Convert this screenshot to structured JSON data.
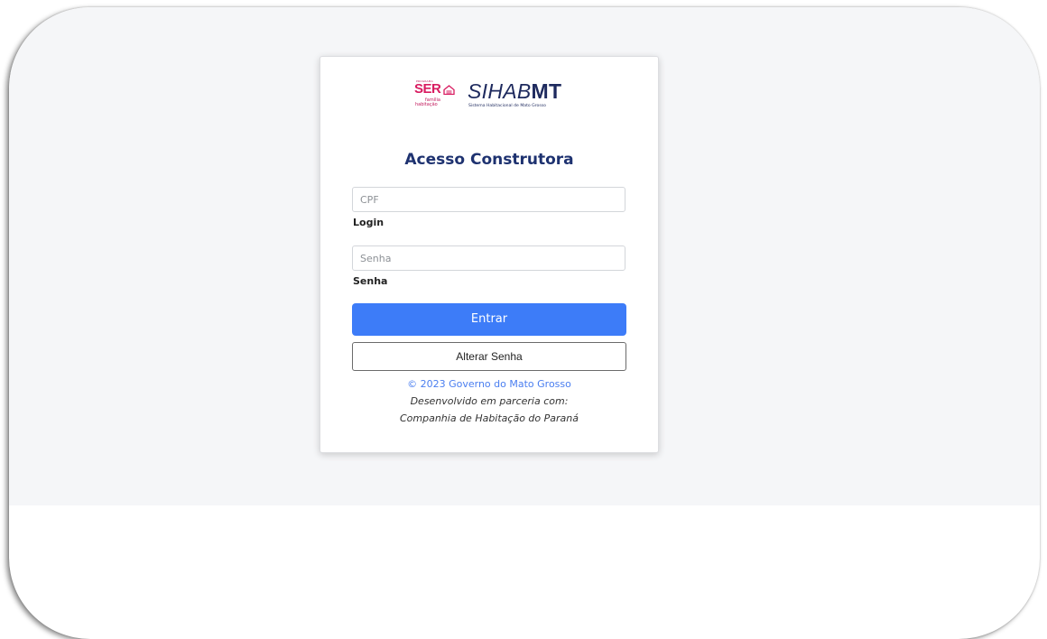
{
  "logo": {
    "ser_top": "PROGRAMA",
    "ser_word": "SER",
    "ser_familia": "família",
    "ser_habitacao": "habitação",
    "sihab_thin": "SIHAB",
    "sihab_bold": "MT",
    "sihab_subtitle": "Sistema Habitacional de Mato Grosso"
  },
  "form": {
    "title": "Acesso Construtora",
    "cpf_placeholder": "CPF",
    "login_label": "Login",
    "senha_placeholder": "Senha",
    "senha_label": "Senha",
    "entrar_label": "Entrar",
    "alterar_senha_label": "Alterar Senha"
  },
  "footer": {
    "copyright": "© 2023 Governo do Mato Grosso",
    "dev_line1": "Desenvolvido em parceria com:",
    "dev_line2": "Companhia de Habitação do Paraná"
  },
  "colors": {
    "primary": "#3d7cf8",
    "title": "#1e3270",
    "brand_pink": "#d81b60",
    "brand_navy": "#1e2a5e"
  }
}
